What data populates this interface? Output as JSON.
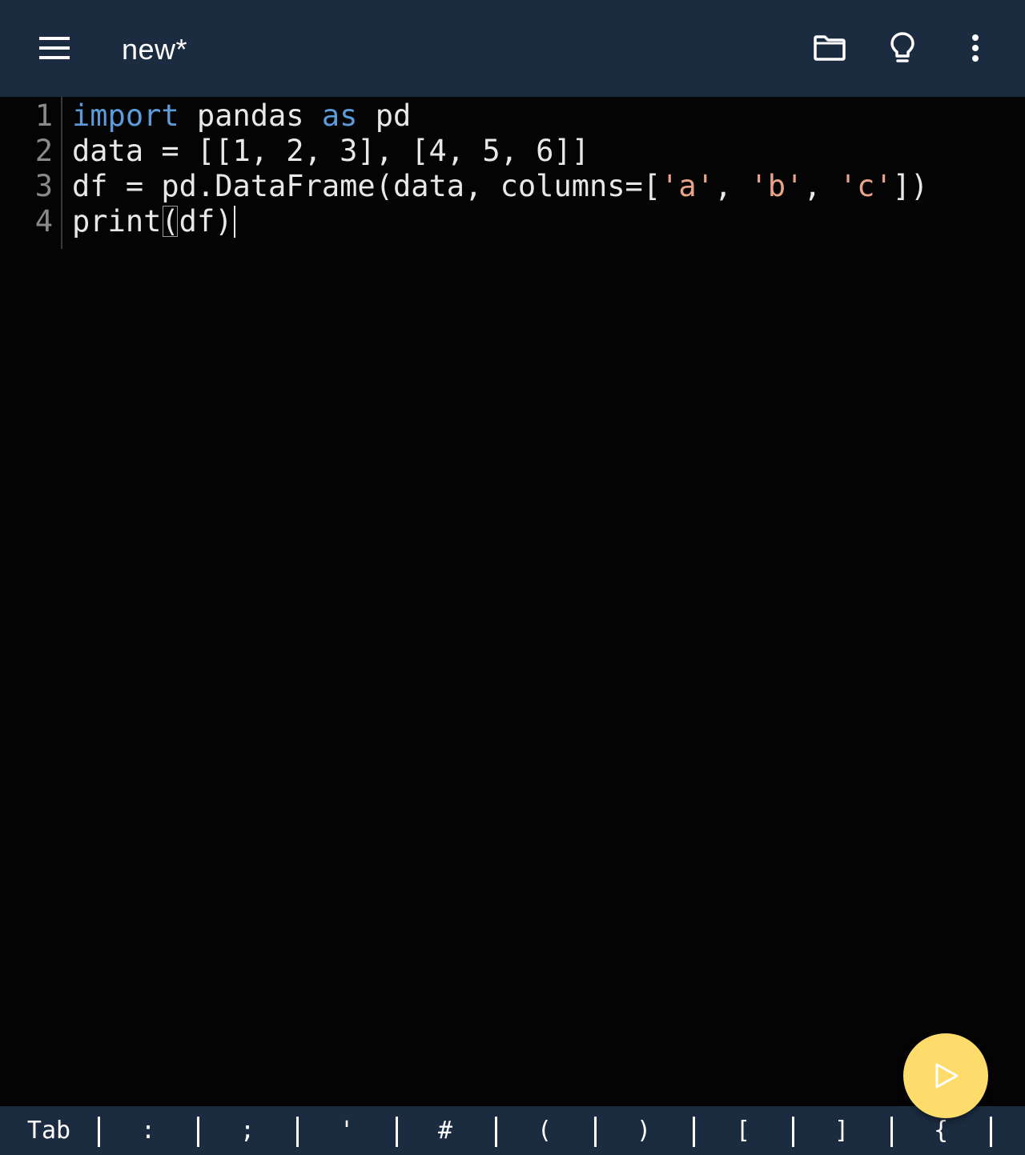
{
  "appbar": {
    "title": "new*",
    "menu_icon": "hamburger-menu-icon",
    "folder_icon": "folder-icon",
    "bulb_icon": "lightbulb-icon",
    "more_icon": "more-vert-icon"
  },
  "editor": {
    "line_numbers": [
      "1",
      "2",
      "3",
      "4"
    ],
    "lines": [
      [
        {
          "t": "import",
          "k": "kw"
        },
        {
          "t": " pandas ",
          "k": "plain"
        },
        {
          "t": "as",
          "k": "kw"
        },
        {
          "t": " pd",
          "k": "plain"
        }
      ],
      [
        {
          "t": "data = [[1, 2, 3], [4, 5, 6]]",
          "k": "plain"
        }
      ],
      [
        {
          "t": "df = pd.DataFrame(data, columns=[",
          "k": "plain"
        },
        {
          "t": "'a'",
          "k": "str"
        },
        {
          "t": ", ",
          "k": "plain"
        },
        {
          "t": "'b'",
          "k": "str"
        },
        {
          "t": ", ",
          "k": "plain"
        },
        {
          "t": "'c'",
          "k": "str"
        },
        {
          "t": "])",
          "k": "plain"
        }
      ],
      [
        {
          "t": "print",
          "k": "plain"
        },
        {
          "t": "(",
          "k": "bracket"
        },
        {
          "t": "df)",
          "k": "plain"
        }
      ]
    ],
    "colors": {
      "keyword": "#5c9ad8",
      "string": "#e8a48a",
      "text": "#e8e8e8"
    }
  },
  "fab": {
    "icon": "play-icon",
    "color": "#fddc6c"
  },
  "symbol_bar": {
    "keys": [
      "Tab",
      ":",
      ";",
      "'",
      "#",
      "(",
      ")",
      "[",
      "]",
      "{"
    ]
  }
}
